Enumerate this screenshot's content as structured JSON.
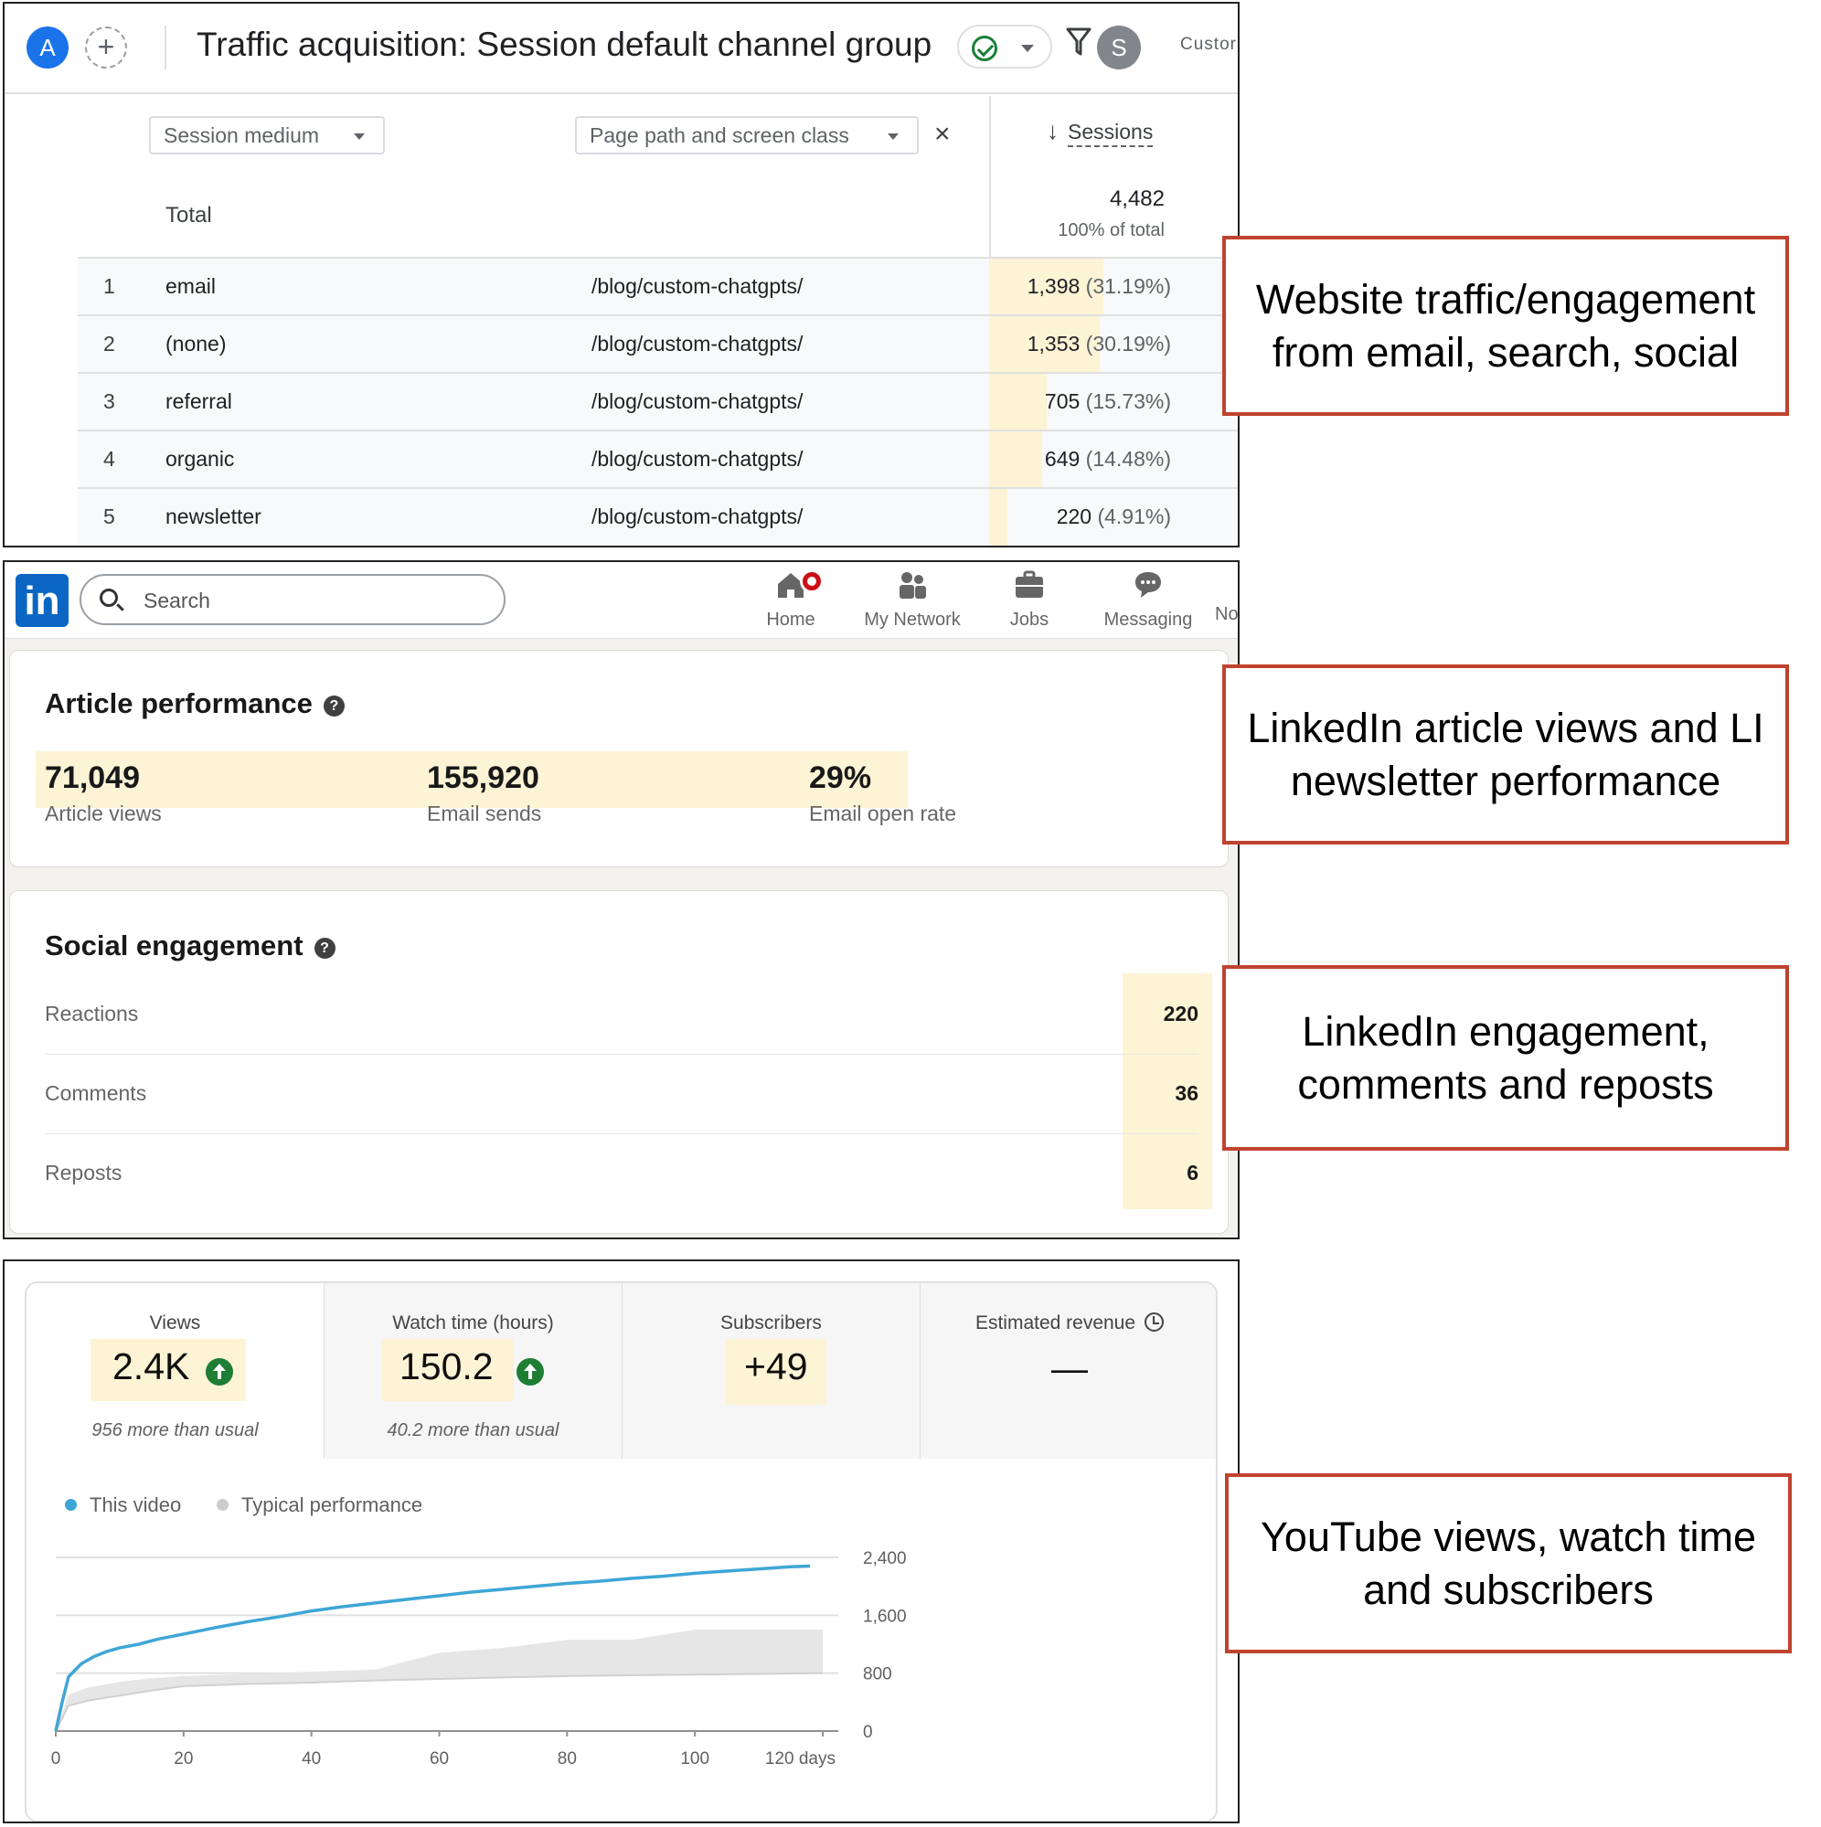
{
  "analytics": {
    "avatar_letter": "A",
    "add_icon": "plus",
    "title": "Traffic acquisition: Session default channel group",
    "user_letter": "S",
    "truncated_label": "Custor",
    "primary_dimension": "Session medium",
    "secondary_dimension": "Page path and screen class",
    "close_glyph": "×",
    "metric_header": "Sessions",
    "sort_glyph": "↓",
    "total_label": "Total",
    "total_value": "4,482",
    "total_pct": "100% of total",
    "rows": [
      {
        "index": "1",
        "medium": "email",
        "path": "/blog/custom-chatgpts/",
        "sessions": "1,398",
        "pct": "(31.19%)",
        "share": 0.3119
      },
      {
        "index": "2",
        "medium": "(none)",
        "path": "/blog/custom-chatgpts/",
        "sessions": "1,353",
        "pct": "(30.19%)",
        "share": 0.3019
      },
      {
        "index": "3",
        "medium": "referral",
        "path": "/blog/custom-chatgpts/",
        "sessions": "705",
        "pct": "(15.73%)",
        "share": 0.1573
      },
      {
        "index": "4",
        "medium": "organic",
        "path": "/blog/custom-chatgpts/",
        "sessions": "649",
        "pct": "(14.48%)",
        "share": 0.1448
      },
      {
        "index": "5",
        "medium": "newsletter",
        "path": "/blog/custom-chatgpts/",
        "sessions": "220",
        "pct": "(4.91%)",
        "share": 0.0491
      }
    ]
  },
  "linkedin": {
    "logo": "in",
    "search_placeholder": "Search",
    "nav": {
      "home": "Home",
      "network": "My Network",
      "jobs": "Jobs",
      "messaging": "Messaging",
      "truncated": "No"
    },
    "article_title": "Article performance",
    "help_glyph": "?",
    "article_stats": [
      {
        "value": "71,049",
        "label": "Article views"
      },
      {
        "value": "155,920",
        "label": "Email sends"
      },
      {
        "value": "29%",
        "label": "Email open rate"
      }
    ],
    "social_title": "Social engagement",
    "social_rows": [
      {
        "label": "Reactions",
        "value": "220"
      },
      {
        "label": "Comments",
        "value": "36"
      },
      {
        "label": "Reposts",
        "value": "6"
      }
    ]
  },
  "youtube": {
    "metrics": [
      {
        "title": "Views",
        "value": "2.4K",
        "sub": "956 more than usual",
        "trend": "up"
      },
      {
        "title": "Watch time (hours)",
        "value": "150.2",
        "sub": "40.2 more than usual",
        "trend": "up"
      },
      {
        "title": "Subscribers",
        "value": "+49",
        "sub": "",
        "trend": ""
      },
      {
        "title": "Estimated revenue",
        "value": "—",
        "sub": "",
        "trend": ""
      }
    ],
    "legend": {
      "this_video": "This video",
      "typical": "Typical performance"
    },
    "colors": {
      "this_video": "#3ea6d6",
      "typical": "#cccccc",
      "highlight": "#fdf3d5",
      "annotation_border": "#c0432f",
      "up_badge": "#1e7e34"
    }
  },
  "chart_data": {
    "type": "line",
    "x_unit": "days",
    "xlim": [
      0,
      122
    ],
    "ylim": [
      0,
      2400
    ],
    "x_ticks": [
      "0",
      "20",
      "40",
      "60",
      "80",
      "100",
      "120 days"
    ],
    "x_tick_values": [
      0,
      20,
      40,
      60,
      80,
      100,
      120
    ],
    "y_ticks": [
      "0",
      "800",
      "1,600",
      "2,400"
    ],
    "y_tick_values": [
      0,
      800,
      1600,
      2400
    ],
    "grid": true,
    "legend_position": "top-left",
    "series": [
      {
        "name": "This video",
        "x": [
          0,
          1,
          2,
          4,
          6,
          8,
          10,
          13,
          16,
          20,
          25,
          30,
          35,
          40,
          45,
          50,
          55,
          60,
          65,
          70,
          75,
          80,
          85,
          90,
          95,
          100,
          105,
          110,
          115,
          118
        ],
        "y": [
          0,
          400,
          750,
          930,
          1030,
          1100,
          1150,
          1200,
          1270,
          1340,
          1430,
          1510,
          1580,
          1660,
          1720,
          1770,
          1820,
          1870,
          1920,
          1960,
          2000,
          2040,
          2070,
          2110,
          2140,
          2180,
          2210,
          2240,
          2270,
          2280
        ]
      },
      {
        "name": "Typical performance",
        "x": [
          0,
          2,
          5,
          10,
          15,
          20,
          30,
          40,
          50,
          60,
          70,
          80,
          90,
          100,
          110,
          120
        ],
        "y_low": [
          0,
          350,
          420,
          490,
          560,
          620,
          650,
          670,
          700,
          720,
          740,
          760,
          770,
          780,
          790,
          800
        ],
        "y_high": [
          0,
          500,
          600,
          680,
          730,
          760,
          790,
          820,
          850,
          1080,
          1150,
          1260,
          1260,
          1400,
          1400,
          1400
        ]
      }
    ]
  },
  "annotations": [
    "Website traffic/engagement from email, search, social",
    "LinkedIn article views and LI newsletter performance",
    "LinkedIn engagement, comments and reposts",
    "YouTube views, watch time and subscribers"
  ]
}
